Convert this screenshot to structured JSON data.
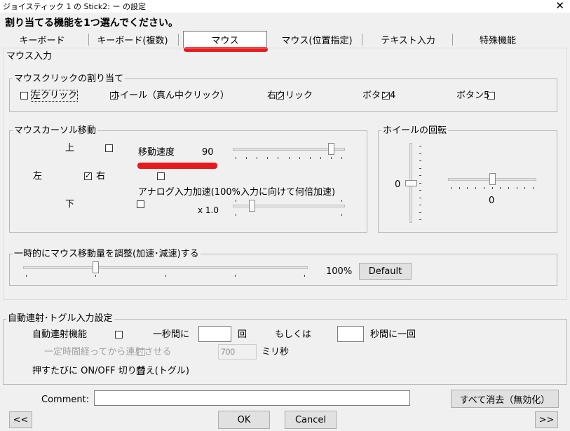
{
  "window": {
    "title": "ジョイスティック 1 の Stick2: ー の設定",
    "close_glyph": "✕"
  },
  "heading": "割り当てる機能を1つ選んでください。",
  "tabs": [
    {
      "label": "キーボード",
      "active": false
    },
    {
      "label": "キーボード(複数)",
      "active": false
    },
    {
      "label": "マウス",
      "active": true
    },
    {
      "label": "マウス(位置指定)",
      "active": false
    },
    {
      "label": "テキスト入力",
      "active": false
    },
    {
      "label": "特殊機能",
      "active": false
    }
  ],
  "mouse_input": {
    "legend": "マウス入力",
    "click_group": {
      "legend": "マウスクリックの割り当て",
      "options": [
        {
          "label": "左クリック",
          "checked": false
        },
        {
          "label": "ホイール（真ん中クリック）",
          "checked": false
        },
        {
          "label": "右クリック",
          "checked": false
        },
        {
          "label": "ボタン4",
          "checked": false
        },
        {
          "label": "ボタン5",
          "checked": false
        }
      ]
    },
    "cursor_group": {
      "legend": "マウスカーソル移動",
      "directions": {
        "up": {
          "label": "上",
          "checked": false
        },
        "left": {
          "label": "左",
          "checked": true
        },
        "right": {
          "label": "右",
          "checked": false
        },
        "down": {
          "label": "下",
          "checked": false
        }
      },
      "speed_label": "移動速度",
      "speed_value": "90",
      "speed_fraction": 0.9,
      "accel_label": "アナログ入力加速(100%入力に向けて何倍加速)",
      "accel_value": "x 1.0",
      "accel_fraction": 0.15
    },
    "wheel_group": {
      "legend": "ホイールの回転",
      "vertical_value": "0",
      "horizontal_value": "0"
    },
    "adjust_group": {
      "legend": "一時的にマウス移動量を調整(加速･減速)する",
      "value": "100%",
      "fraction": 0.25,
      "default_button": "Default"
    }
  },
  "auto_fire": {
    "legend": "自動連射･トグル入力設定",
    "enable": {
      "label": "自動連射機能",
      "checked": false
    },
    "per_second_label": "一秒間に",
    "per_second_value": "",
    "times_label": "回",
    "or_label": "もしくは",
    "seconds_value": "",
    "seconds_label": "秒間に一回",
    "delay": {
      "label": "一定時間経ってから連射させる",
      "checked": false,
      "disabled": true
    },
    "delay_value": "700",
    "delay_unit": "ミリ秒",
    "toggle": {
      "label": "押すたびに ON/OFF 切り替え(トグル)",
      "checked": false
    }
  },
  "footer": {
    "comment_label": "Comment:",
    "comment_value": "",
    "clear_all_button": "すべて消去（無効化）",
    "prev_button": "<<",
    "ok_button": "OK",
    "cancel_button": "Cancel",
    "next_button": ">>"
  },
  "colors": {
    "annotation": "#e8191c",
    "background": "#f0f0f0"
  }
}
